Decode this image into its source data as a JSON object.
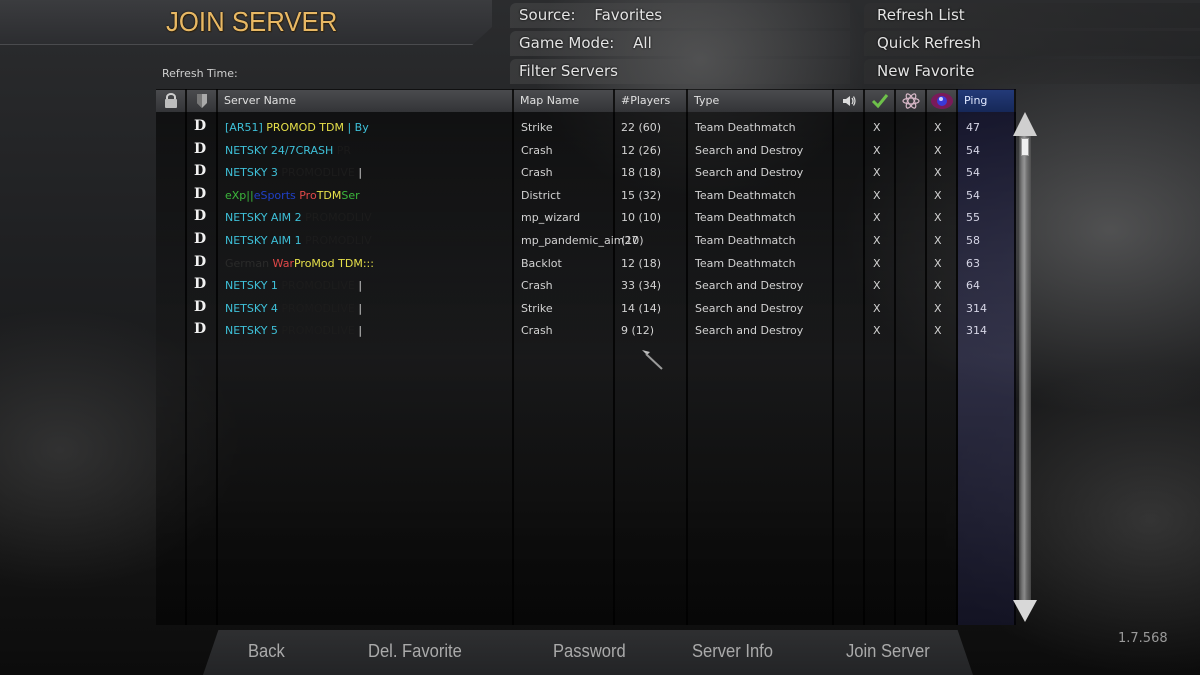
{
  "header": {
    "title": "JOIN SERVER",
    "refresh_time_label": "Refresh Time:"
  },
  "filters": {
    "source_label": "Source:",
    "source_value": "Favorites",
    "game_mode_label": "Game Mode:",
    "game_mode_value": "All",
    "filter_servers": "Filter Servers"
  },
  "actions": {
    "refresh_list": "Refresh List",
    "quick_refresh": "Quick Refresh",
    "new_favorite": "New Favorite"
  },
  "table": {
    "columns": {
      "lock_icon": "lock-icon",
      "favorite_icon": "shield-icon",
      "server_name": "Server Name",
      "map_name": "Map Name",
      "players": "#Players",
      "type": "Type",
      "voice_icon": "speaker-icon",
      "punkbuster_icon": "checkmark-icon",
      "mod_icon": "atom-icon",
      "hardcore_icon": "orb-icon",
      "ping": "Ping"
    },
    "rows": [
      {
        "flag": "D",
        "name_parts": [
          {
            "text": "[AR51] ",
            "color": "#3ec0d8"
          },
          {
            "text": "PROMOD TDM",
            "color": "#e6e04a"
          },
          {
            "text": " | By",
            "color": "#3ec0d8"
          }
        ],
        "map": "Strike",
        "players": "22 (60)",
        "type": "Team Deathmatch",
        "voice": "X",
        "hardcore": "X",
        "ping": "47"
      },
      {
        "flag": "D",
        "name_parts": [
          {
            "text": "NETSKY ",
            "color": "#3ec0d8"
          },
          {
            "text": "24/7CRASH",
            "color": "#3ec0d8"
          },
          {
            "text": " PR",
            "color": "#1a1a1a"
          }
        ],
        "map": "Crash",
        "players": "12 (26)",
        "type": "Search and Destroy",
        "voice": "X",
        "hardcore": "X",
        "ping": "54"
      },
      {
        "flag": "D",
        "name_parts": [
          {
            "text": "NETSKY 3 ",
            "color": "#3ec0d8"
          },
          {
            "text": "PROMODLIVE",
            "color": "#1c1c1c"
          },
          {
            "text": " |",
            "color": "#cfcfcf"
          }
        ],
        "map": "Crash",
        "players": "18 (18)",
        "type": "Search and Destroy",
        "voice": "X",
        "hardcore": "X",
        "ping": "54"
      },
      {
        "flag": "D",
        "name_parts": [
          {
            "text": "eXp||",
            "color": "#3cb83c"
          },
          {
            "text": "eSports ",
            "color": "#2040c8"
          },
          {
            "text": "Pro",
            "color": "#e04848"
          },
          {
            "text": "TDM",
            "color": "#e6e04a"
          },
          {
            "text": "Ser",
            "color": "#3cb83c"
          }
        ],
        "map": "District",
        "players": "15 (32)",
        "type": "Team Deathmatch",
        "voice": "X",
        "hardcore": "X",
        "ping": "54"
      },
      {
        "flag": "D",
        "name_parts": [
          {
            "text": "NETSKY AIM 2 ",
            "color": "#3ec0d8"
          },
          {
            "text": "PROMODLIV",
            "color": "#1c1c1c"
          }
        ],
        "map": "mp_wizard",
        "players": "10 (10)",
        "type": "Team Deathmatch",
        "voice": "X",
        "hardcore": "X",
        "ping": "55"
      },
      {
        "flag": "D",
        "name_parts": [
          {
            "text": "NETSKY AIM 1 ",
            "color": "#3ec0d8"
          },
          {
            "text": "PROMODLIV",
            "color": "#1c1c1c"
          }
        ],
        "map": "mp_pandemic_aim27",
        "players": "(10)",
        "type": "Team Deathmatch",
        "voice": "X",
        "hardcore": "X",
        "ping": "58"
      },
      {
        "flag": "D",
        "name_parts": [
          {
            "text": "German ",
            "color": "#2a2a2a"
          },
          {
            "text": "War",
            "color": "#e04848"
          },
          {
            "text": "ProMod TDM:::",
            "color": "#e6e04a"
          }
        ],
        "map": "Backlot",
        "players": "12 (18)",
        "type": "Team Deathmatch",
        "voice": "X",
        "hardcore": "X",
        "ping": "63"
      },
      {
        "flag": "D",
        "name_parts": [
          {
            "text": "NETSKY 1 ",
            "color": "#3ec0d8"
          },
          {
            "text": "PROMODLIVE",
            "color": "#1c1c1c"
          },
          {
            "text": " |",
            "color": "#cfcfcf"
          }
        ],
        "map": "Crash",
        "players": "33 (34)",
        "type": "Search and Destroy",
        "voice": "X",
        "hardcore": "X",
        "ping": "64"
      },
      {
        "flag": "D",
        "name_parts": [
          {
            "text": "NETSKY 4 ",
            "color": "#3ec0d8"
          },
          {
            "text": "PROMODLIVE",
            "color": "#1c1c1c"
          },
          {
            "text": " |",
            "color": "#cfcfcf"
          }
        ],
        "map": "Strike",
        "players": "14 (14)",
        "type": "Search and Destroy",
        "voice": "X",
        "hardcore": "X",
        "ping": "314"
      },
      {
        "flag": "D",
        "name_parts": [
          {
            "text": "NETSKY 5 ",
            "color": "#3ec0d8"
          },
          {
            "text": "PROMODLIVE",
            "color": "#1c1c1c"
          },
          {
            "text": " |",
            "color": "#cfcfcf"
          }
        ],
        "map": "Crash",
        "players": "9 (12)",
        "type": "Search and Destroy",
        "voice": "X",
        "hardcore": "X",
        "ping": "314"
      }
    ]
  },
  "footer": {
    "back": "Back",
    "del_favorite": "Del. Favorite",
    "password": "Password",
    "server_info": "Server Info",
    "join_server": "Join Server",
    "version": "1.7.568"
  },
  "colors": {
    "title": "#e8b864",
    "ping_header": "#1e3270",
    "server_cyan": "#3ec0d8"
  }
}
